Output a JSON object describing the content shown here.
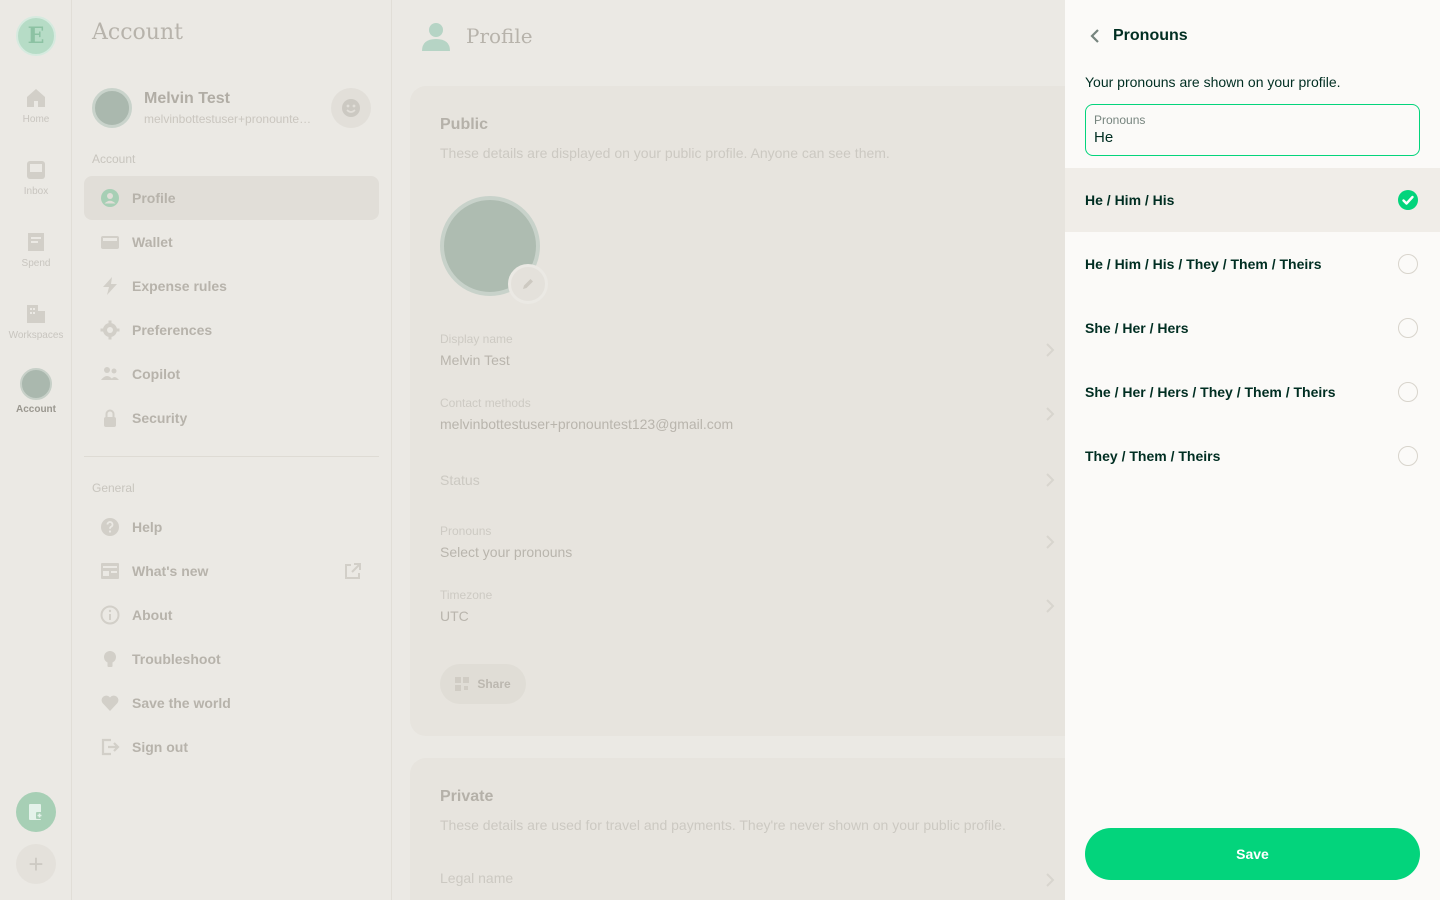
{
  "rail": {
    "items": [
      {
        "label": "Home",
        "icon": "home-icon"
      },
      {
        "label": "Inbox",
        "icon": "inbox-icon"
      },
      {
        "label": "Spend",
        "icon": "spend-icon"
      },
      {
        "label": "Workspaces",
        "icon": "workspaces-icon"
      },
      {
        "label": "Account",
        "icon": "avatar",
        "active": true
      }
    ],
    "logo_letter": "E",
    "plus_glyph": "+"
  },
  "account": {
    "title": "Account",
    "user": {
      "name": "Melvin Test",
      "email": "melvinbottestuser+pronountest123@gmail.com"
    },
    "section_account": "Account",
    "account_items": [
      {
        "label": "Profile",
        "icon": "person-icon",
        "active": true
      },
      {
        "label": "Wallet",
        "icon": "wallet-icon"
      },
      {
        "label": "Expense rules",
        "icon": "lightning-icon"
      },
      {
        "label": "Preferences",
        "icon": "gear-icon"
      },
      {
        "label": "Copilot",
        "icon": "users-icon"
      },
      {
        "label": "Security",
        "icon": "lock-icon"
      }
    ],
    "section_general": "General",
    "general_items": [
      {
        "label": "Help",
        "icon": "question-icon"
      },
      {
        "label": "What's new",
        "icon": "news-icon",
        "external": true
      },
      {
        "label": "About",
        "icon": "info-icon"
      },
      {
        "label": "Troubleshoot",
        "icon": "bulb-icon"
      },
      {
        "label": "Save the world",
        "icon": "heart-icon"
      },
      {
        "label": "Sign out",
        "icon": "exit-icon"
      }
    ]
  },
  "profile": {
    "title": "Profile",
    "public": {
      "title": "Public",
      "subtitle": "These details are displayed on your public profile. Anyone can see them.",
      "fields": [
        {
          "label": "Display name",
          "value": "Melvin Test"
        },
        {
          "label": "Contact methods",
          "value": "melvinbottestuser+pronountest123@gmail.com"
        },
        {
          "label": "",
          "value": "Status"
        },
        {
          "label": "Pronouns",
          "value": "Select your pronouns"
        },
        {
          "label": "Timezone",
          "value": "UTC"
        }
      ],
      "share_label": "Share"
    },
    "private": {
      "title": "Private",
      "subtitle": "These details are used for travel and payments. They're never shown on your public profile.",
      "field_label": "Legal name"
    }
  },
  "panel": {
    "title": "Pronouns",
    "description": "Your pronouns are shown on your profile.",
    "input": {
      "label": "Pronouns",
      "value": "He"
    },
    "options": [
      {
        "label": "He / Him / His",
        "selected": true
      },
      {
        "label": "He / Him / His / They / Them / Theirs",
        "selected": false
      },
      {
        "label": "She / Her / Hers",
        "selected": false
      },
      {
        "label": "She / Her / Hers / They / Them / Theirs",
        "selected": false
      },
      {
        "label": "They / Them / Theirs",
        "selected": false
      }
    ],
    "save_label": "Save"
  },
  "colors": {
    "accent": "#03d47c",
    "text_dark": "#002e22",
    "panel_bg": "#fbfaf8",
    "overlay_bg": "#ebe9e4"
  }
}
